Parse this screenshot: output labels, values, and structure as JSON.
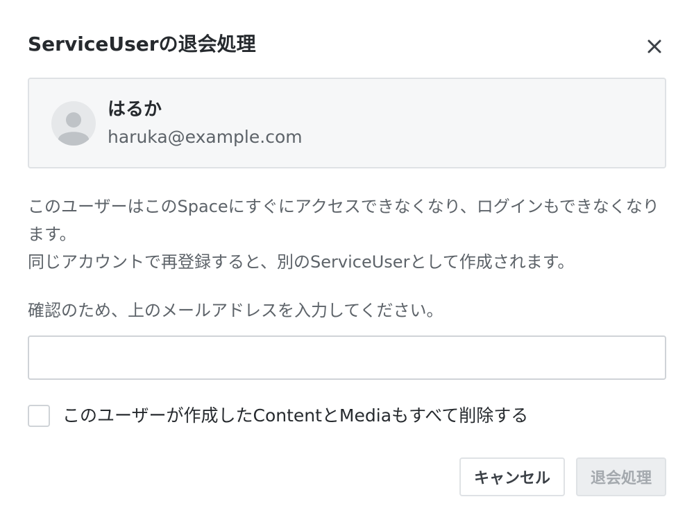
{
  "dialog": {
    "title": "ServiceUserの退会処理",
    "close_icon": "close-icon"
  },
  "user": {
    "name": "はるか",
    "email": "haruka@example.com",
    "avatar_icon": "default-avatar-icon"
  },
  "description": {
    "line1": "このユーザーはこのSpaceにすぐにアクセスできなくなり、ログインもできなくなります。",
    "line2": "同じアカウントで再登録すると、別のServiceUserとして作成されます。"
  },
  "confirm": {
    "label": "確認のため、上のメールアドレスを入力してください。",
    "value": "",
    "placeholder": ""
  },
  "checkbox": {
    "label": "このユーザーが作成したContentとMediaもすべて削除する",
    "checked": false
  },
  "buttons": {
    "cancel": "キャンセル",
    "delete": "退会処理",
    "delete_disabled": true
  },
  "colors": {
    "title_text": "#262a2e",
    "body_text": "#5d6369",
    "border": "#dfe2e5",
    "card_background": "#f6f7f8",
    "disabled_text": "#a4a9ae"
  }
}
